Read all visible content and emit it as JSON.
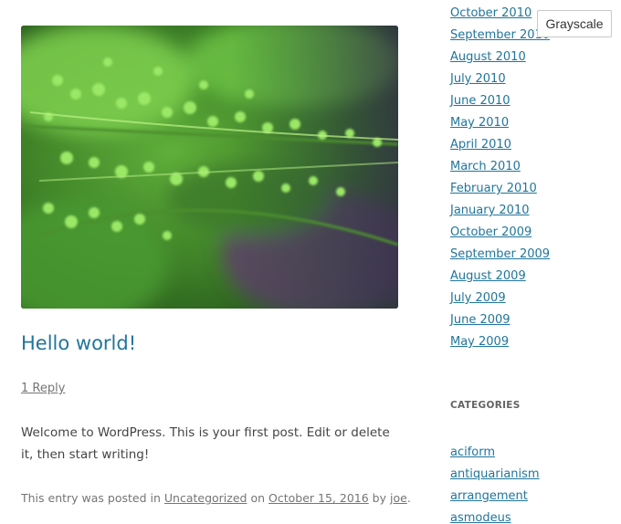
{
  "post": {
    "title": "Hello world!",
    "reply_link": "1 Reply",
    "content": "Welcome to WordPress. This is your first post. Edit or delete it, then start writing!",
    "meta": {
      "prefix": "This entry was posted in",
      "category": "Uncategorized",
      "on": "on",
      "date": "October 15, 2016",
      "by": "by",
      "author": "joe",
      "suffix": "."
    }
  },
  "sidebar": {
    "archives": [
      "October 2010",
      "September 2010",
      "August 2010",
      "July 2010",
      "June 2010",
      "May 2010",
      "April 2010",
      "March 2010",
      "February 2010",
      "January 2010",
      "October 2009",
      "September 2009",
      "August 2009",
      "July 2009",
      "June 2009",
      "May 2009"
    ],
    "categories_title": "CATEGORIES",
    "categories": [
      "aciform",
      "antiquarianism",
      "arrangement",
      "asmodeus"
    ]
  },
  "toolbar": {
    "grayscale_label": "Grayscale"
  },
  "colors": {
    "link": "#21759b",
    "meta_text": "#757575",
    "fern_light": "#8fe05a",
    "fern_dark": "#2f6a1f"
  }
}
